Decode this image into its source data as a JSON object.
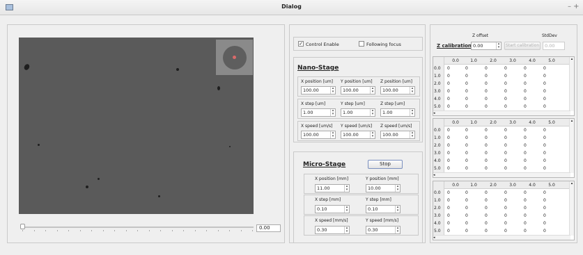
{
  "window": {
    "title": "Dialog",
    "controls": "– +"
  },
  "image_view": {
    "slider_value": "0.00"
  },
  "controls": {
    "control_enable": "Control Enable",
    "following_focus": "Following focus"
  },
  "nano": {
    "title": "Nano-Stage",
    "pos": {
      "labels": [
        "X position [um]",
        "Y position [um]",
        "Z position [um]"
      ],
      "values": [
        "100.00",
        "100.00",
        "100.00"
      ]
    },
    "step": {
      "labels": [
        "X step [um]",
        "Y step [um]",
        "Z step [um]"
      ],
      "values": [
        "1.00",
        "1.00",
        "1.00"
      ]
    },
    "speed": {
      "labels": [
        "X speed [um/s]",
        "Y speed [um/s]",
        "Z speed [um/s]"
      ],
      "values": [
        "100.00",
        "100.00",
        "100.00"
      ]
    }
  },
  "micro": {
    "title": "Micro-Stage",
    "stop": "Stop",
    "pos": {
      "labels": [
        "X position [mm]",
        "Y position [mm]"
      ],
      "values": [
        "11.00",
        "10.00"
      ]
    },
    "step": {
      "labels": [
        "X step [mm]",
        "Y step [mm]"
      ],
      "values": [
        "0.10",
        "0.10"
      ]
    },
    "speed": {
      "labels": [
        "X speed [mm/s]",
        "Y speed [mm/s]"
      ],
      "values": [
        "0.30",
        "0.30"
      ]
    }
  },
  "zcal": {
    "z_offset_label": "Z offset",
    "stddev_label": "StdDev",
    "button": "Z calibration",
    "value": "0.00",
    "start": "Start calibration",
    "stddev": "0.00"
  },
  "grid": {
    "cols": [
      "0.0",
      "1.0",
      "2.0",
      "3.0",
      "4.0",
      "5.0"
    ],
    "rows": [
      "0.0",
      "1.0",
      "2.0",
      "3.0",
      "4.0",
      "5.0"
    ],
    "cell": "0"
  }
}
